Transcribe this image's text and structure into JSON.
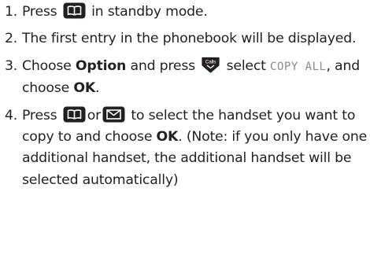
{
  "steps": [
    {
      "num": "1.",
      "a": "Press",
      "b": "in standby mode."
    },
    {
      "num": "2.",
      "text": "The first entry in the phonebook will be displayed."
    },
    {
      "num": "3.",
      "a": "Choose",
      "option": "Option",
      "b": "and press",
      "c": "select",
      "lcd": "COPY ALL",
      "d": ", and choose",
      "ok": "OK",
      "e": "."
    },
    {
      "num": "4.",
      "a": "Press",
      "or": "or",
      "b": "to select the handset you want to copy to and choose",
      "ok": "OK",
      "c": ". (Note: if you only have one additional handset, the additional handset will be selected automatically)"
    }
  ],
  "icons": {
    "book": "phonebook-key-icon",
    "calls": "calls-key-icon",
    "envelope": "messages-key-icon"
  },
  "icon_text": {
    "calls": "Calls"
  },
  "colors": {
    "key_fill": "#231f20",
    "key_glyph": "#ffffff",
    "text": "#231f20",
    "lcd_text": "#8a8a8a"
  }
}
